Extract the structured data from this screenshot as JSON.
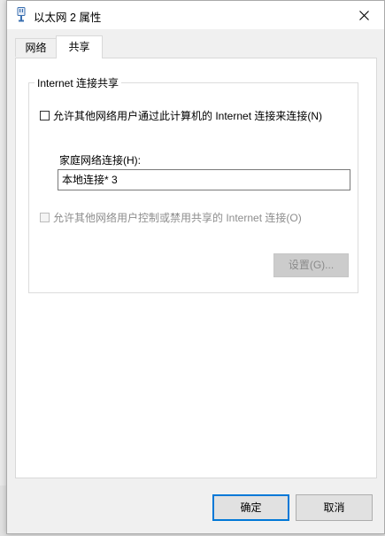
{
  "window": {
    "title": "以太网 2 属性",
    "title_icon": "network-adapter-icon",
    "close_icon": "close-icon"
  },
  "tabs": [
    {
      "label": "网络",
      "selected": false
    },
    {
      "label": "共享",
      "selected": true
    }
  ],
  "sharing": {
    "group_title": "Internet 连接共享",
    "allow_share_label": "允许其他网络用户通过此计算机的 Internet 连接来连接(N)",
    "allow_share_checked": false,
    "home_network_label": "家庭网络连接(H):",
    "home_network_value": "本地连接* 3",
    "allow_control_label": "允许其他网络用户控制或禁用共享的 Internet 连接(O)",
    "allow_control_checked": false,
    "allow_control_enabled": false,
    "settings_button": "设置(G)...",
    "settings_enabled": false
  },
  "buttons": {
    "ok": "确定",
    "cancel": "取消"
  },
  "colors": {
    "accent": "#0078d7",
    "dialog_bg": "#f0f0f0",
    "disabled_text": "#8d8d8d"
  }
}
